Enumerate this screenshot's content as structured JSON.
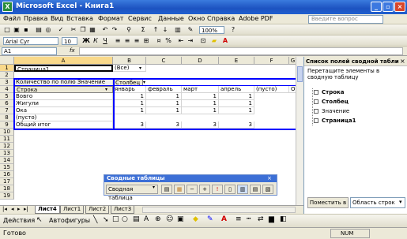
{
  "titlebar": {
    "title": "Microsoft Excel - Книга1",
    "min": "_",
    "restore": "▫",
    "close": "×"
  },
  "menubar": {
    "items": [
      "Файл",
      "Правка",
      "Вид",
      "Вставка",
      "Формат",
      "Сервис",
      "Данные",
      "Окно",
      "Справка",
      "Adobe PDF"
    ],
    "help_placeholder": "Введите вопрос"
  },
  "formatbar": {
    "font": "Arial Cyr",
    "size": "10",
    "bold": "Ж",
    "italic": "К",
    "underline": "Ч",
    "zoom": "100%"
  },
  "formulabar": {
    "namebox": "A1",
    "fx": "fx",
    "value": ""
  },
  "columns": [
    "A",
    "B",
    "C",
    "D",
    "E",
    "F",
    "G"
  ],
  "rows": [
    "1",
    "2",
    "3",
    "4",
    "5",
    "6",
    "7",
    "8",
    "9",
    "10",
    "11",
    "12",
    "13",
    "14",
    "15",
    "16",
    "17",
    "18",
    "19"
  ],
  "pivot": {
    "page_label": "Страница1",
    "page_value": "(Все)",
    "data_label": "Количество по полю Значение",
    "col_field": "Столбец",
    "row_field": "Строка",
    "col_headers": [
      "январь",
      "февраль",
      "март",
      "апрель",
      "(пусто)",
      "О"
    ],
    "row_items": [
      "Вовго",
      "Жигули",
      "Ока",
      "(пусто)"
    ],
    "values": [
      [
        "1",
        "1",
        "1",
        "1"
      ],
      [
        "1",
        "1",
        "1",
        "1"
      ],
      [
        "1",
        "1",
        "1",
        "1"
      ]
    ],
    "total_label": "Общий итог",
    "totals": [
      "3",
      "3",
      "3",
      "3"
    ]
  },
  "sheets": [
    "Лист4",
    "Лист1",
    "Лист2",
    "Лист3"
  ],
  "pane": {
    "title": "Список полей сводной табли",
    "hint": "Перетащите элементы в сводную таблицу",
    "fields": [
      "Строка",
      "Столбец",
      "Значение",
      "Страница1"
    ],
    "place_button": "Поместить в",
    "area_select": "Область строк"
  },
  "pivottb": {
    "title": "Сводные таблицы",
    "menu": "Сводная таблица"
  },
  "drawbar": {
    "actions": "Действия",
    "autoshapes": "Автофигуры"
  },
  "status": {
    "left": "Готово",
    "num": "NUM"
  }
}
